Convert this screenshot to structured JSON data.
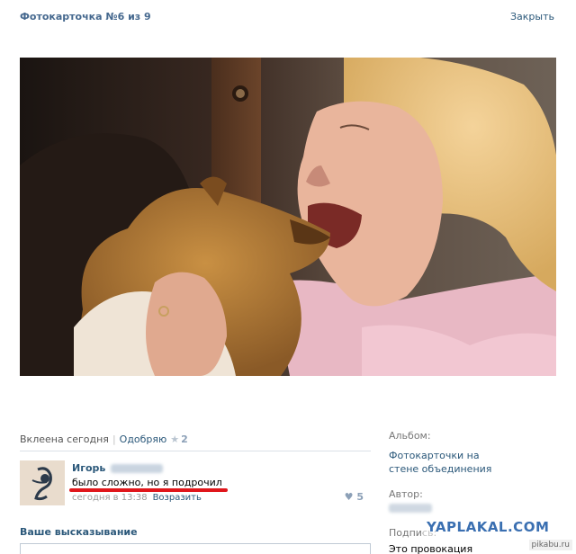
{
  "header": {
    "title": "Фотокарточка №6 из 9",
    "close_label": "Закрыть"
  },
  "photo": {
    "alt": "photo-girl-puppy"
  },
  "meta": {
    "posted": "Вклеена сегодня",
    "approve": "Одобряю",
    "likes": "2"
  },
  "comment": {
    "author": "Игорь",
    "text": "было сложно, но я подрочил",
    "date": "сегодня в 13:38",
    "reply": "Возразить",
    "likes": "5"
  },
  "your_opinion": "Ваше высказывание",
  "sidebar": {
    "album_label": "Альбом:",
    "album_value": "Фотокарточки на стене объединения",
    "author_label": "Автор:",
    "caption_label": "Подпись:",
    "caption_value": "Это провокация"
  },
  "watermark": "YAPLAKAL.COM",
  "pikabu": "pikabu.ru",
  "colors": {
    "link": "#2b587a",
    "accent": "#45688e",
    "underline": "#e0161b"
  }
}
